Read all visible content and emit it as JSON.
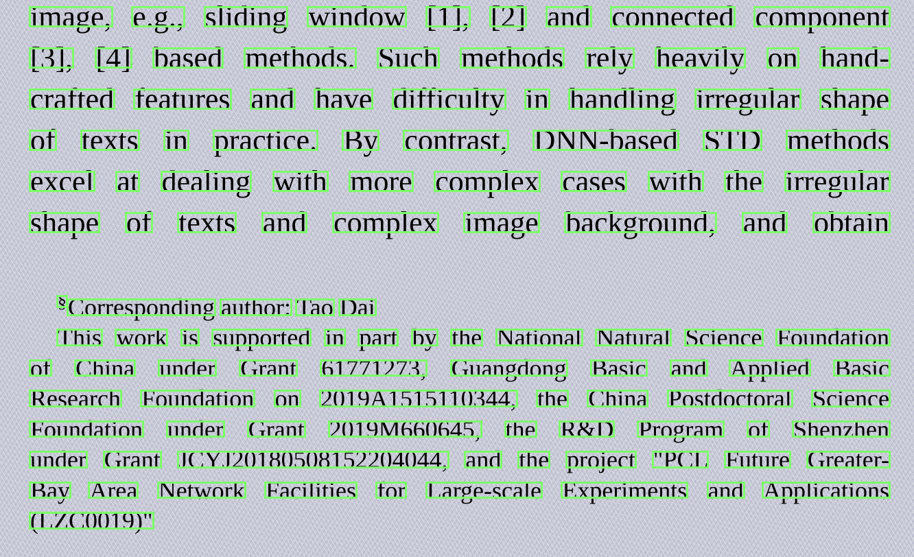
{
  "body": {
    "lines": [
      "image, e.g., sliding window [1], [2] and connected component",
      "[3], [4] based methods. Such methods rely heavily on hand-",
      "crafted features and have difficulty in handling irregular shape",
      "of texts in practice. By contrast, DNN-based STD methods",
      "excel at dealing with more complex cases with the irregular",
      "shape of texts and complex image background, and obtain"
    ]
  },
  "footnotes": {
    "author_mark": "§",
    "author": "Corresponding author: Tao Dai",
    "funding_lines": [
      "This work is supported in part by the National Natural Science Foundation",
      "of China under Grant 61771273, Guangdong Basic and Applied Basic",
      "Research Foundation on 2019A1515110344, the China Postdoctoral Science",
      "Foundation under Grant 2019M660645, the R&D Program of Shenzhen",
      "under Grant JCYJ20180508152204044, and the project \"PCL Future Greater-",
      "Bay Area Network Facilities for Large-scale Experiments and Applications",
      "(LZC0019)\""
    ]
  },
  "colors": {
    "background": "#c6c8d6",
    "ocr_box": "#7dff6a",
    "text": "#000000"
  }
}
